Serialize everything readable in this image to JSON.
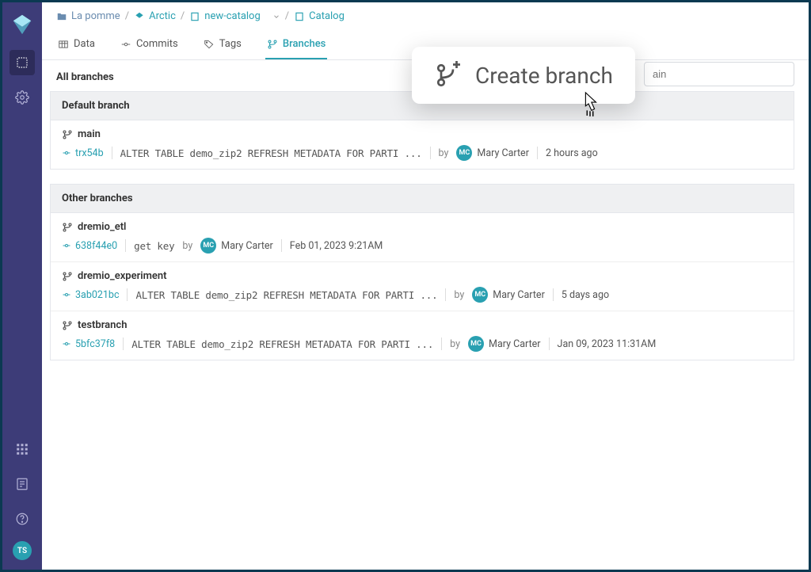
{
  "breadcrumb": {
    "root": "La pomme",
    "arctic": "Arctic",
    "catalog_name": "new-catalog",
    "catalog": "Catalog"
  },
  "tabs": {
    "data": "Data",
    "commits": "Commits",
    "tags": "Tags",
    "branches": "Branches"
  },
  "heading": "All branches",
  "search_placeholder": "ain",
  "create_branch_label": "Create branch",
  "sections": {
    "default": {
      "title": "Default branch",
      "branches": [
        {
          "name": "main",
          "hash": "trx54b",
          "msg": "ALTER TABLE demo_zip2 REFRESH METADATA FOR PARTI ...",
          "user_initials": "MC",
          "user_name": "Mary Carter",
          "time": "2 hours ago"
        }
      ]
    },
    "other": {
      "title": "Other branches",
      "branches": [
        {
          "name": "dremio_etl",
          "hash": "638f44e0",
          "msg": "get key",
          "user_initials": "MC",
          "user_name": "Mary Carter",
          "time": "Feb 01, 2023 9:21AM"
        },
        {
          "name": "dremio_experiment",
          "hash": "3ab021bc",
          "msg": "ALTER TABLE demo_zip2 REFRESH METADATA FOR PARTI ...",
          "user_initials": "MC",
          "user_name": "Mary Carter",
          "time": "5 days ago"
        },
        {
          "name": "testbranch",
          "hash": "5bfc37f8",
          "msg": "ALTER TABLE demo_zip2 REFRESH METADATA FOR PARTI ...",
          "user_initials": "MC",
          "user_name": "Mary Carter",
          "time": "Jan 09, 2023 11:31AM"
        }
      ]
    }
  },
  "by_label": "by",
  "sidebar_user": "TS"
}
